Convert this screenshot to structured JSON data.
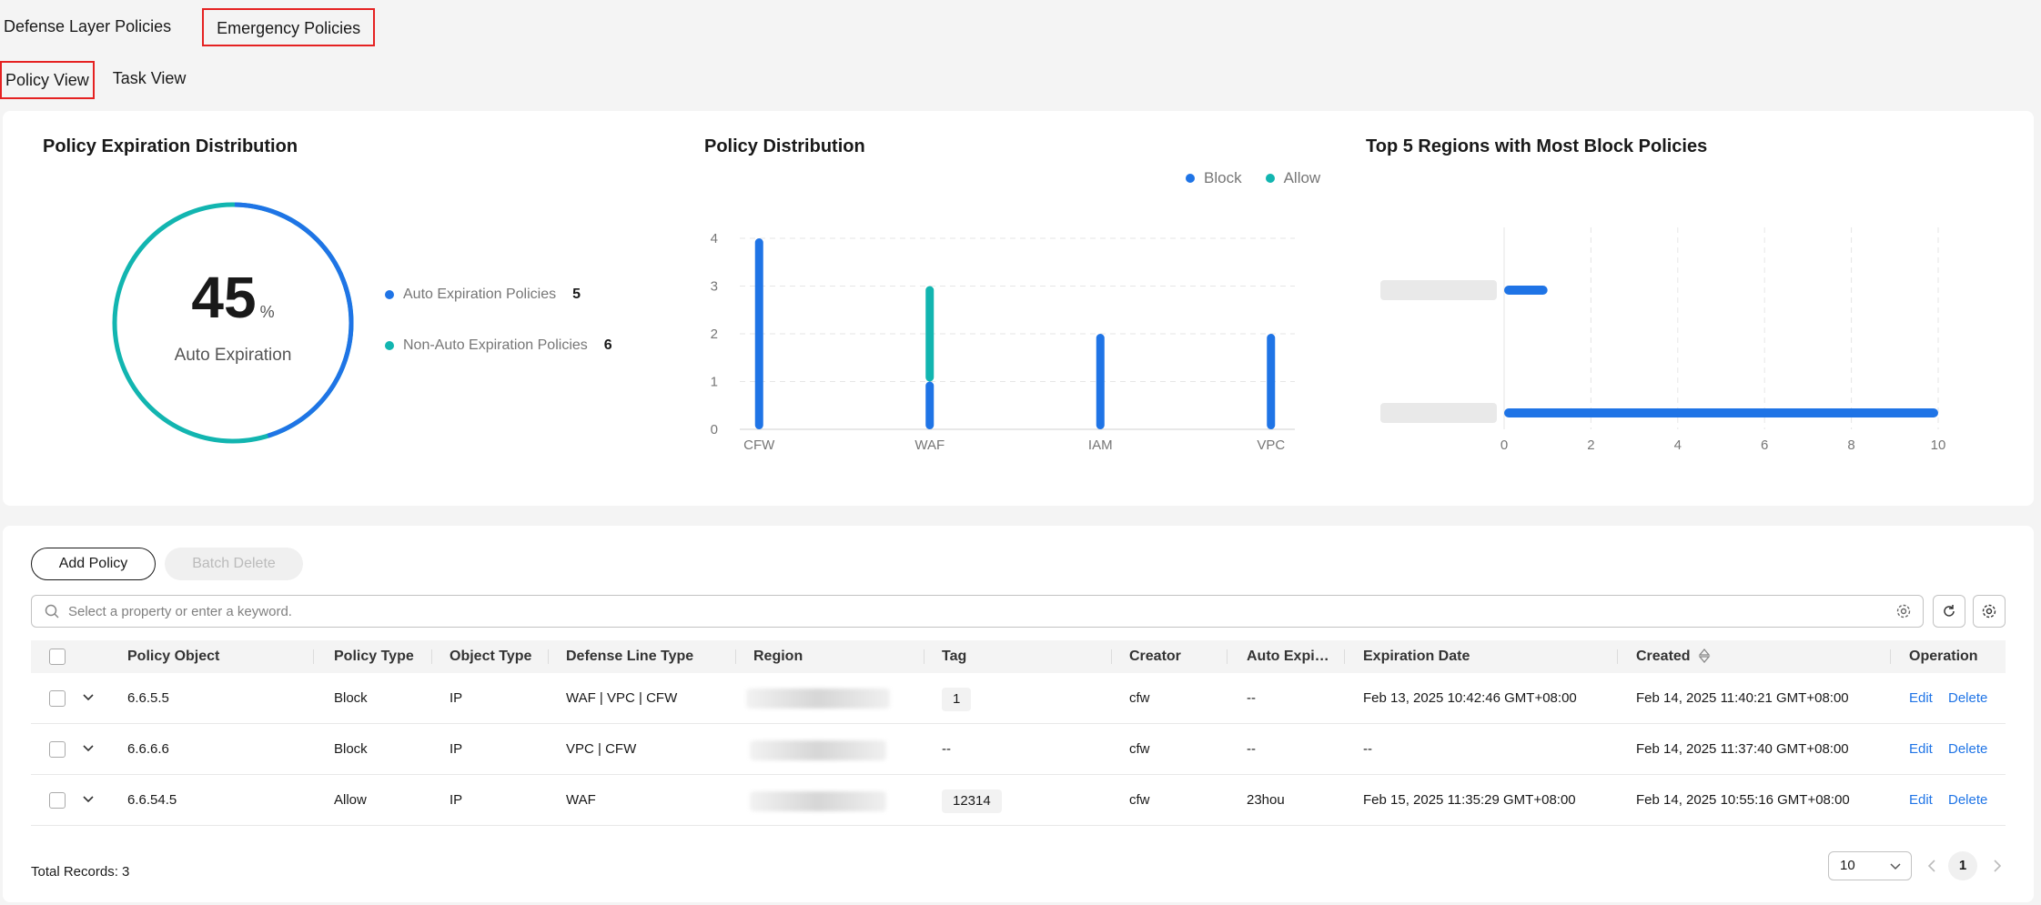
{
  "top_tabs": [
    {
      "label": "Defense Layer Policies",
      "active": false
    },
    {
      "label": "Emergency Policies",
      "active": true
    }
  ],
  "sub_tabs": [
    {
      "label": "Policy View",
      "active": true
    },
    {
      "label": "Task View",
      "active": false
    }
  ],
  "expiration_chart": {
    "title": "Policy Expiration Distribution",
    "percent": "45",
    "percent_unit": "%",
    "center_label": "Auto Expiration",
    "legend": [
      {
        "label": "Auto Expiration Policies",
        "count": "5",
        "color": "#1f74e6"
      },
      {
        "label": "Non-Auto Expiration Policies",
        "count": "6",
        "color": "#12b5b0"
      }
    ]
  },
  "distribution_chart": {
    "title": "Policy Distribution",
    "legend": [
      {
        "label": "Block",
        "color": "#1f74e6"
      },
      {
        "label": "Allow",
        "color": "#12b5b0"
      }
    ]
  },
  "regions_chart": {
    "title": "Top 5 Regions with Most Block Policies"
  },
  "chart_data": [
    {
      "type": "pie",
      "categories": [
        "Auto Expiration Policies",
        "Non-Auto Expiration Policies"
      ],
      "values": [
        5,
        6
      ],
      "title": "Policy Expiration Distribution"
    },
    {
      "type": "bar",
      "title": "Policy Distribution",
      "categories": [
        "CFW",
        "WAF",
        "IAM",
        "VPC"
      ],
      "series": [
        {
          "name": "Block",
          "values": [
            4,
            1,
            2,
            2
          ]
        },
        {
          "name": "Allow",
          "values": [
            0,
            2,
            0,
            0
          ]
        }
      ],
      "stacked": true,
      "ylim": [
        0,
        4
      ],
      "yticks": [
        "0",
        "1",
        "2",
        "3",
        "4"
      ],
      "grid": true,
      "legend": "top-right"
    },
    {
      "type": "bar",
      "orientation": "horizontal",
      "title": "Top 5 Regions with Most Block Policies",
      "categories": [
        "",
        ""
      ],
      "values": [
        1,
        10
      ],
      "xlim": [
        0,
        10
      ],
      "xticks": [
        "0",
        "2",
        "4",
        "6",
        "8",
        "10"
      ],
      "grid": true
    }
  ],
  "toolbar": {
    "add_label": "Add Policy",
    "batch_delete_label": "Batch Delete",
    "search_placeholder": "Select a property or enter a keyword."
  },
  "table": {
    "columns": [
      "Policy Object",
      "Policy Type",
      "Object Type",
      "Defense Line Type",
      "Region",
      "Tag",
      "Creator",
      "Auto Expi…",
      "Expiration Date",
      "Created",
      "Operation"
    ],
    "rows": [
      {
        "object": "6.6.5.5",
        "policy_type": "Block",
        "object_type": "IP",
        "defense_line": "WAF | VPC | CFW",
        "tag": "1",
        "creator": "cfw",
        "auto_exp": "--",
        "exp_date": "Feb 13, 2025 10:42:46 GMT+08:00",
        "created": "Feb 14, 2025 11:40:21 GMT+08:00",
        "edit": "Edit",
        "delete": "Delete"
      },
      {
        "object": "6.6.6.6",
        "policy_type": "Block",
        "object_type": "IP",
        "defense_line": "VPC | CFW",
        "tag": "--",
        "creator": "cfw",
        "auto_exp": "--",
        "exp_date": "--",
        "created": "Feb 14, 2025 11:37:40 GMT+08:00",
        "edit": "Edit",
        "delete": "Delete"
      },
      {
        "object": "6.6.54.5",
        "policy_type": "Allow",
        "object_type": "IP",
        "defense_line": "WAF",
        "tag": "12314",
        "creator": "cfw",
        "auto_exp": "23hou",
        "exp_date": "Feb 15, 2025 11:35:29 GMT+08:00",
        "created": "Feb 14, 2025 10:55:16 GMT+08:00",
        "edit": "Edit",
        "delete": "Delete"
      }
    ]
  },
  "footer": {
    "total": "Total Records: 3",
    "page_size": "10",
    "current_page": "1"
  }
}
